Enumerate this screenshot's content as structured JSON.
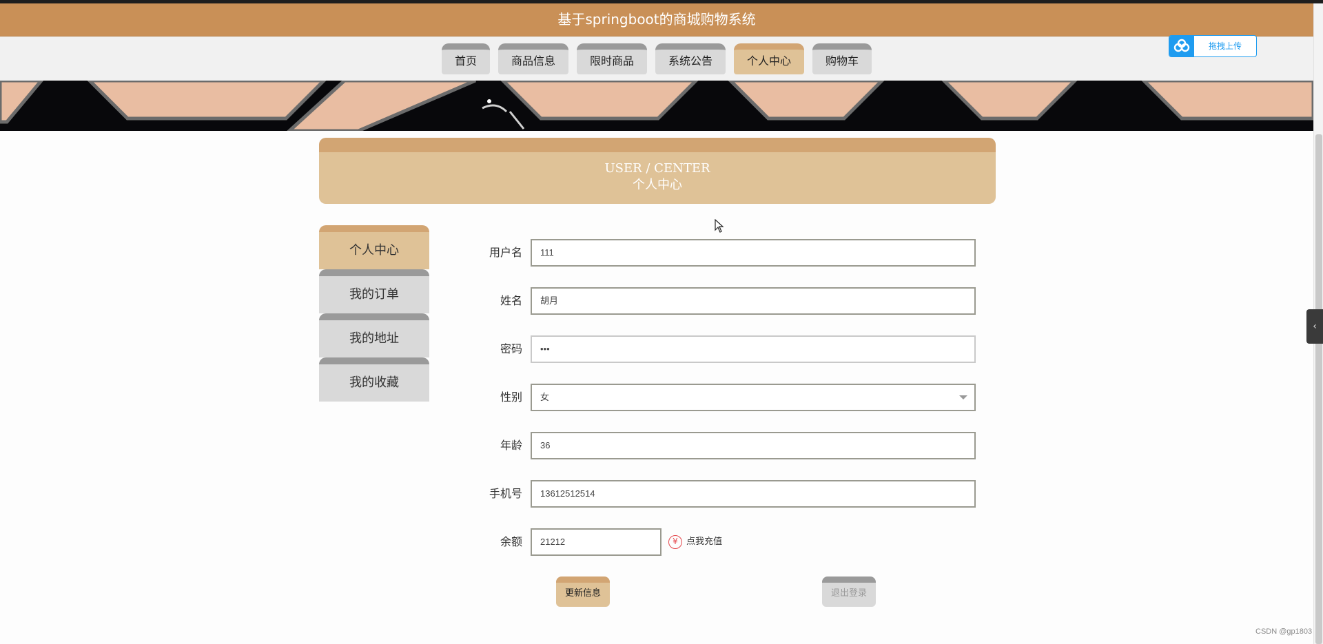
{
  "app": {
    "title": "基于springboot的商城购物系统"
  },
  "nav": {
    "tabs": [
      {
        "label": "首页",
        "active": false
      },
      {
        "label": "商品信息",
        "active": false
      },
      {
        "label": "限时商品",
        "active": false
      },
      {
        "label": "系统公告",
        "active": false
      },
      {
        "label": "个人中心",
        "active": true
      },
      {
        "label": "购物车",
        "active": false
      }
    ]
  },
  "upload": {
    "label": "拖拽上传",
    "icon": "cloud-upload-icon"
  },
  "user_center": {
    "title_en": "USER / CENTER",
    "title_cn": "个人中心"
  },
  "side_menu": {
    "items": [
      {
        "label": "个人中心",
        "active": true
      },
      {
        "label": "我的订单",
        "active": false
      },
      {
        "label": "我的地址",
        "active": false
      },
      {
        "label": "我的收藏",
        "active": false
      }
    ]
  },
  "form": {
    "username_label": "用户名",
    "username_value": "111",
    "name_label": "姓名",
    "name_value": "胡月",
    "password_label": "密码",
    "password_value": "•••",
    "gender_label": "性别",
    "gender_value": "女",
    "age_label": "年龄",
    "age_value": "36",
    "phone_label": "手机号",
    "phone_value": "13612512514",
    "balance_label": "余额",
    "balance_value": "21212",
    "recharge_label": "点我充值",
    "recharge_icon": "¥"
  },
  "buttons": {
    "update_label": "更新信息",
    "logout_label": "退出登录"
  },
  "watermark": "CSDN @gp1803",
  "colors": {
    "header": "#c99057",
    "active_tab": "#dfc297",
    "active_tab_top": "#d2a573",
    "inactive_tab": "#d9d9d9",
    "upload_accent": "#1f9cf0"
  }
}
